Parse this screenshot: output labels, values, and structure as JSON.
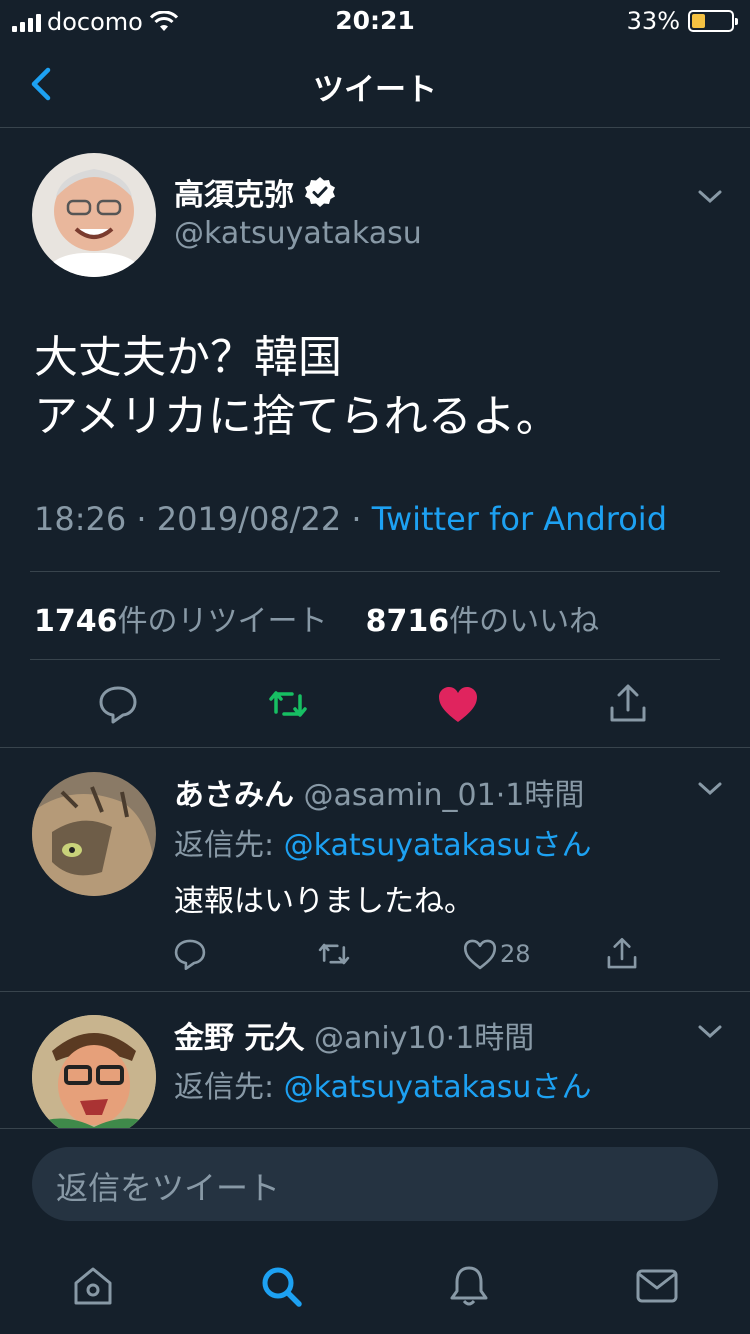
{
  "status_bar": {
    "carrier": "docomo",
    "time": "20:21",
    "battery": "33%",
    "battery_level": 0.33,
    "battery_color": "#f5c242"
  },
  "nav": {
    "title": "ツイート"
  },
  "main_tweet": {
    "name": "高須克弥",
    "handle": "@katsuyatakasu",
    "verified": true,
    "text_line1": "大丈夫か？韓国",
    "text_line2": "アメリカに捨てられるよ。",
    "time": "18:26",
    "date": "2019/08/22",
    "separator": "·",
    "source": "Twitter for Android",
    "retweet_count": "1746",
    "retweet_label": "件のリツイート",
    "like_count": "8716",
    "like_label": "件のいいね",
    "liked": true,
    "retweeted": true
  },
  "replies": [
    {
      "name": "あさみん",
      "handle": "@asamin_01",
      "time": "1時間",
      "reply_prefix": "返信先: ",
      "reply_to": "@katsuyatakasu",
      "reply_suffix": "さん",
      "text": "速報はいりましたね。",
      "likes": "28"
    },
    {
      "name": "金野 元久",
      "handle": "@aniy10",
      "time": "1時間",
      "reply_prefix": "返信先: ",
      "reply_to": "@katsuyatakasu",
      "reply_suffix": "さん"
    }
  ],
  "compose": {
    "placeholder": "返信をツイート"
  },
  "tabs": [
    "home-icon",
    "search-icon",
    "notifications-icon",
    "messages-icon"
  ],
  "colors": {
    "background": "#15202b",
    "accent": "#1da1f2",
    "muted": "#8899a6",
    "like": "#e0245e",
    "retweet": "#17bf63",
    "divider": "#38444d"
  }
}
